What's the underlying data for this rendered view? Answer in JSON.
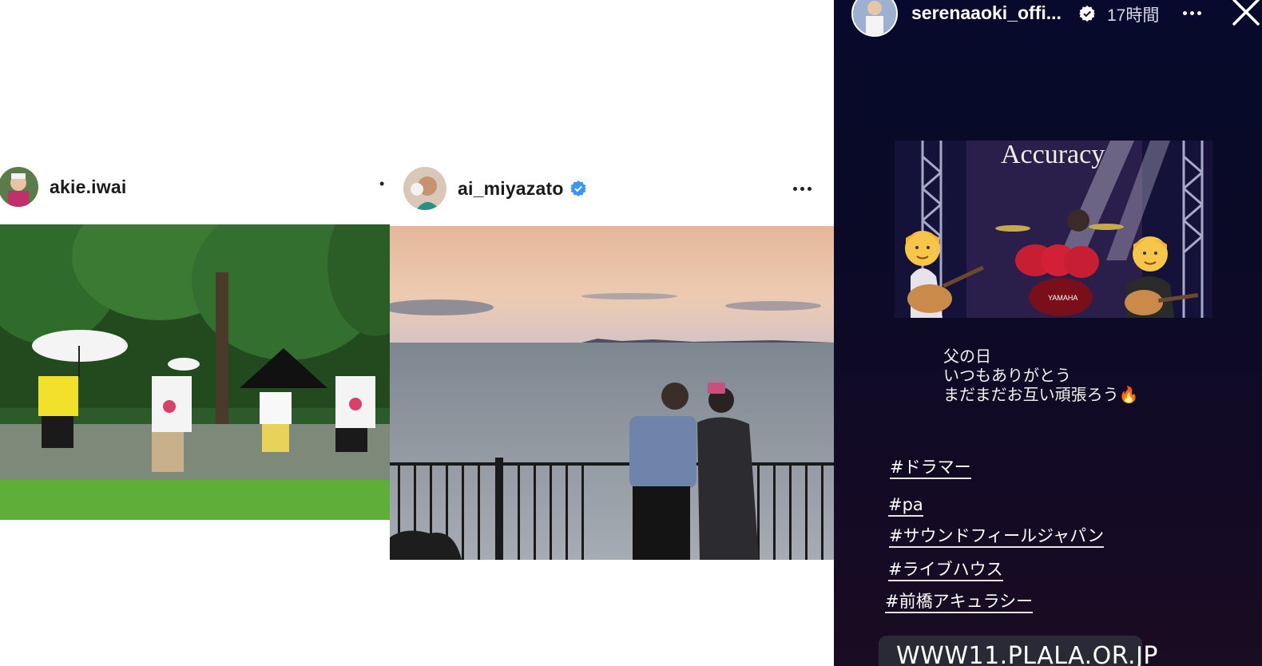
{
  "left_post": {
    "username": "akie.iwai",
    "more_glyph": "•"
  },
  "middle_post": {
    "username": "ai_miyazato",
    "verified": true,
    "accent": "#3897f0"
  },
  "right_story": {
    "username": "serenaaoki_offi...",
    "time": "17時間",
    "verified": true,
    "banner_sign": "Accuracy",
    "drum_brand": "YAMAHA",
    "caption": "父の日\nいつもありがとう\nまだまだお互い頑張ろう🔥",
    "hashtags": [
      "#ドラマー",
      "#pa",
      "#サウンドフィールジャパン",
      "#ライブハウス",
      "#前橋アキュラシー"
    ],
    "link_label": "WWW11.PLALA.OR.JP",
    "icons": {
      "more": "more-horizontal-icon",
      "close": "close-icon",
      "link": "link-icon",
      "verified": "verified-badge-icon"
    }
  }
}
